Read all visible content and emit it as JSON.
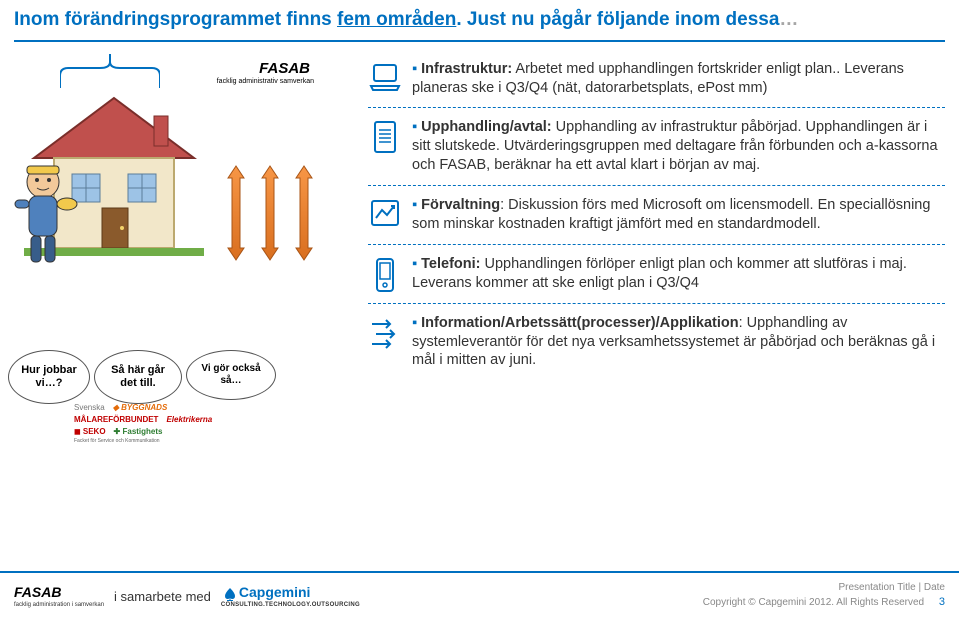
{
  "title": {
    "prefix": "Inom förändringsprogrammet finns ",
    "underlined": "fem områden",
    "mid": ". Just nu pågår följande inom dessa",
    "ellipsis": "…"
  },
  "illustration": {
    "brand": "FASAB",
    "brand_sub": "facklig administrativ samverkan"
  },
  "bubbles": {
    "b1": "Hur jobbar vi…?",
    "b2": "Så här går det till.",
    "b3": "Vi gör också så…"
  },
  "logos": {
    "l1": "Svenska",
    "l2": "BYGGNADS",
    "l3": "MÅLAREFÖRBUNDET",
    "l4": "Elektrikerna",
    "l5": "SEKO",
    "l5sub": "Facket för Service och Kommunikation",
    "l6": "Fastighets"
  },
  "items": {
    "infra": "Infrastruktur: Arbetet med upphandlingen fortskrider enligt plan.. Leverans planeras ske i Q3/Q4 (nät, datorarbetsplats, ePost mm)",
    "infra_bold": "Infrastruktur:",
    "avtal": "Upphandling/avtal: Upphandling av infrastruktur påbörjad. Upphandlingen är i sitt slutskede. Utvärderingsgruppen med deltagare från förbunden och a-kassorna och FASAB, beräknar ha ett avtal klart i början av maj.",
    "avtal_bold": "Upphandling/avtal:",
    "forvaltning": "Förvaltning: Diskussion förs med Microsoft om licensmodell. En speciallösning som minskar kostnaden kraftigt jämfört med en standardmodell.",
    "forvaltning_bold": "Förvaltning",
    "telefoni": "Telefoni: Upphandlingen förlöper enligt plan och kommer att slutföras i maj. Leverans kommer att ske enligt plan i Q3/Q4",
    "telefoni_bold": "Telefoni:",
    "info": "Information/Arbetssätt(processer)/Applikation: Upphandling av systemleverantör för det nya verksamhetssystemet är påbörjad och beräknas gå i mål i mitten av juni.",
    "info_bold": "Information/Arbetssätt(processer)/Applikation"
  },
  "footer": {
    "fasab": "FASAB",
    "fasab_sub": "facklig administration i samverkan",
    "samarbete": "i samarbete med",
    "capgemini": "Capgemini",
    "capgemini_sub": "CONSULTING.TECHNOLOGY.OUTSOURCING",
    "pres": "Presentation Title | Date",
    "copyright": "Copyright © Capgemini 2012. All Rights Reserved",
    "page": "3"
  }
}
